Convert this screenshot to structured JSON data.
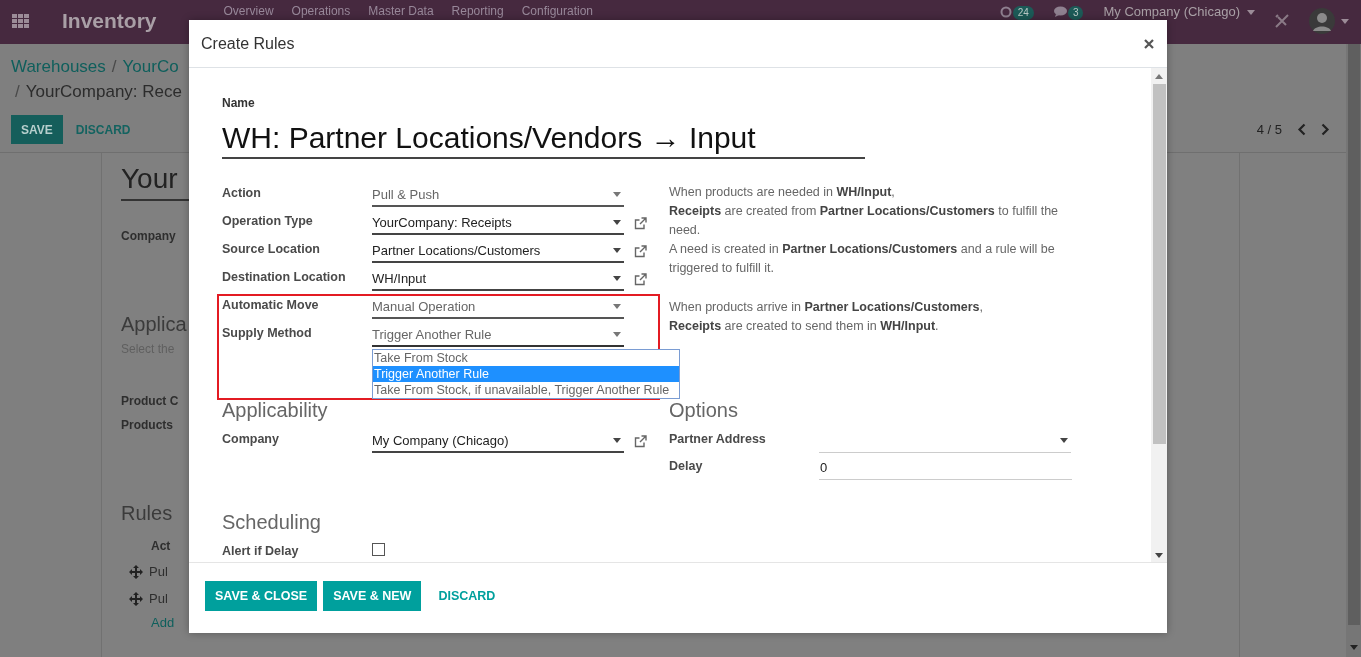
{
  "navbar": {
    "app_title": "Inventory",
    "menu": [
      "Overview",
      "Operations",
      "Master Data",
      "Reporting",
      "Configuration"
    ],
    "activity_count": "24",
    "message_count": "3",
    "company": "My Company (Chicago)"
  },
  "control_panel": {
    "breadcrumb": [
      {
        "kind": "link",
        "text": "Warehouses"
      },
      {
        "kind": "separator",
        "text": "/"
      },
      {
        "kind": "link",
        "text": "YourCo"
      }
    ],
    "breadcrumb_line_2": [
      {
        "kind": "separator",
        "text": "/"
      },
      {
        "kind": "current",
        "text": "YourCompany: Rece"
      }
    ],
    "buttons": [
      {
        "kind": "primary",
        "label": "SAVE"
      },
      {
        "kind": "link",
        "label": "DISCARD"
      }
    ],
    "pager": "4 / 5"
  },
  "sheet": {
    "items": [
      {
        "kind": "title",
        "text": "Your"
      },
      {
        "kind": "label",
        "text": "Company"
      },
      {
        "kind": "section",
        "text": "Applica"
      },
      {
        "kind": "hint",
        "text": "Select the"
      },
      {
        "kind": "label",
        "text": "Product C"
      },
      {
        "kind": "label",
        "text": "Products"
      },
      {
        "kind": "section",
        "text": "Rules"
      },
      {
        "kind": "column_header",
        "text": "Act"
      },
      {
        "kind": "row",
        "text": "Pul"
      },
      {
        "kind": "row",
        "text": "Pul"
      },
      {
        "kind": "add_link",
        "text": "Add"
      }
    ]
  },
  "dialog": {
    "title": "Create Rules",
    "name_label": "Name",
    "name_value": "WH: Partner Locations/Vendors → Input",
    "groups": [
      {
        "highlighted": false,
        "fields": [
          {
            "label": "Action",
            "kind": "select",
            "value": "Pull & Push"
          },
          {
            "label": "Operation Type",
            "kind": "many2one",
            "value": "YourCompany: Receipts"
          },
          {
            "label": "Source Location",
            "kind": "many2one",
            "value": "Partner Locations/Customers"
          },
          {
            "label": "Destination Location",
            "kind": "many2one",
            "value": "WH/Input"
          }
        ],
        "description": [
          "When products are needed in **WH/Input**,",
          "**Receipts** are created from **Partner Locations/Customers** to fulfill the need.",
          "A need is created in **Partner Locations/Customers** and a rule will be triggered to fulfill it."
        ]
      },
      {
        "highlighted": true,
        "fields": [
          {
            "label": "Automatic Move",
            "kind": "select",
            "value": "Manual Operation"
          },
          {
            "label": "Supply Method",
            "kind": "select",
            "value": "Trigger Another Rule",
            "expanded": true,
            "options": [
              {
                "label": "Take From Stock",
                "selected": false
              },
              {
                "label": "Trigger Another Rule",
                "selected": true
              },
              {
                "label": "Take From Stock, if unavailable, Trigger Another Rule",
                "selected": false
              }
            ]
          }
        ],
        "description": [
          "When products arrive in **Partner Locations/Customers**,",
          "**Receipts** are created to send them in **WH/Input**."
        ]
      }
    ],
    "sections": [
      {
        "columns": [
          {
            "title": "Applicability",
            "fields": [
              {
                "label": "Company",
                "kind": "many2one",
                "value": "My Company (Chicago)"
              }
            ]
          },
          {
            "title": "Options",
            "fields": [
              {
                "label": "Partner Address",
                "kind": "dropdown"
              },
              {
                "label": "Delay",
                "kind": "input",
                "value": "0"
              }
            ]
          }
        ]
      },
      {
        "columns": [
          {
            "title": "Scheduling",
            "fields": [
              {
                "label": "Alert if Delay",
                "kind": "checkbox",
                "checked": false
              }
            ]
          }
        ]
      }
    ],
    "footer_buttons": [
      {
        "kind": "primary",
        "label": "SAVE & CLOSE"
      },
      {
        "kind": "primary",
        "label": "SAVE & NEW"
      },
      {
        "kind": "link",
        "label": "DISCARD"
      }
    ]
  }
}
